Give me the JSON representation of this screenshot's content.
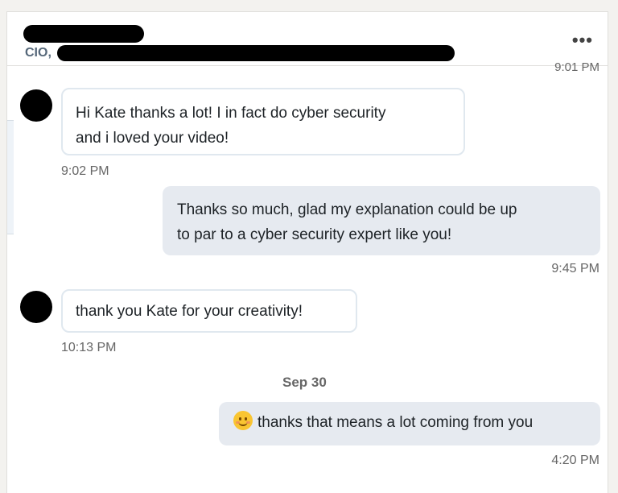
{
  "header": {
    "name": "",
    "title_prefix": "CIO,",
    "more_label": "•••",
    "clipped_time": "9:01 PM"
  },
  "messages": [
    {
      "direction": "incoming",
      "text_line1": "Hi Kate thanks a lot! I in fact do cyber security",
      "text_line2": "and i loved your video!",
      "time": "9:02 PM"
    },
    {
      "direction": "outgoing",
      "text_line1": "Thanks so much, glad my explanation could be up",
      "text_line2": "to par to a cyber security expert like you!",
      "time": "9:45 PM"
    },
    {
      "direction": "incoming",
      "text_line1": "thank you Kate for your creativity!",
      "time": "10:13 PM"
    },
    {
      "direction": "outgoing",
      "emoji": "smiling-face-emoji",
      "text_line1": "thanks that means a lot coming from you",
      "time": "4:20 PM"
    }
  ],
  "date_separator": "Sep 30",
  "colors": {
    "incoming_border": "#e0e8ef",
    "outgoing_bg": "#e6eaf0",
    "timestamp": "#666666",
    "redaction": "#000000"
  }
}
